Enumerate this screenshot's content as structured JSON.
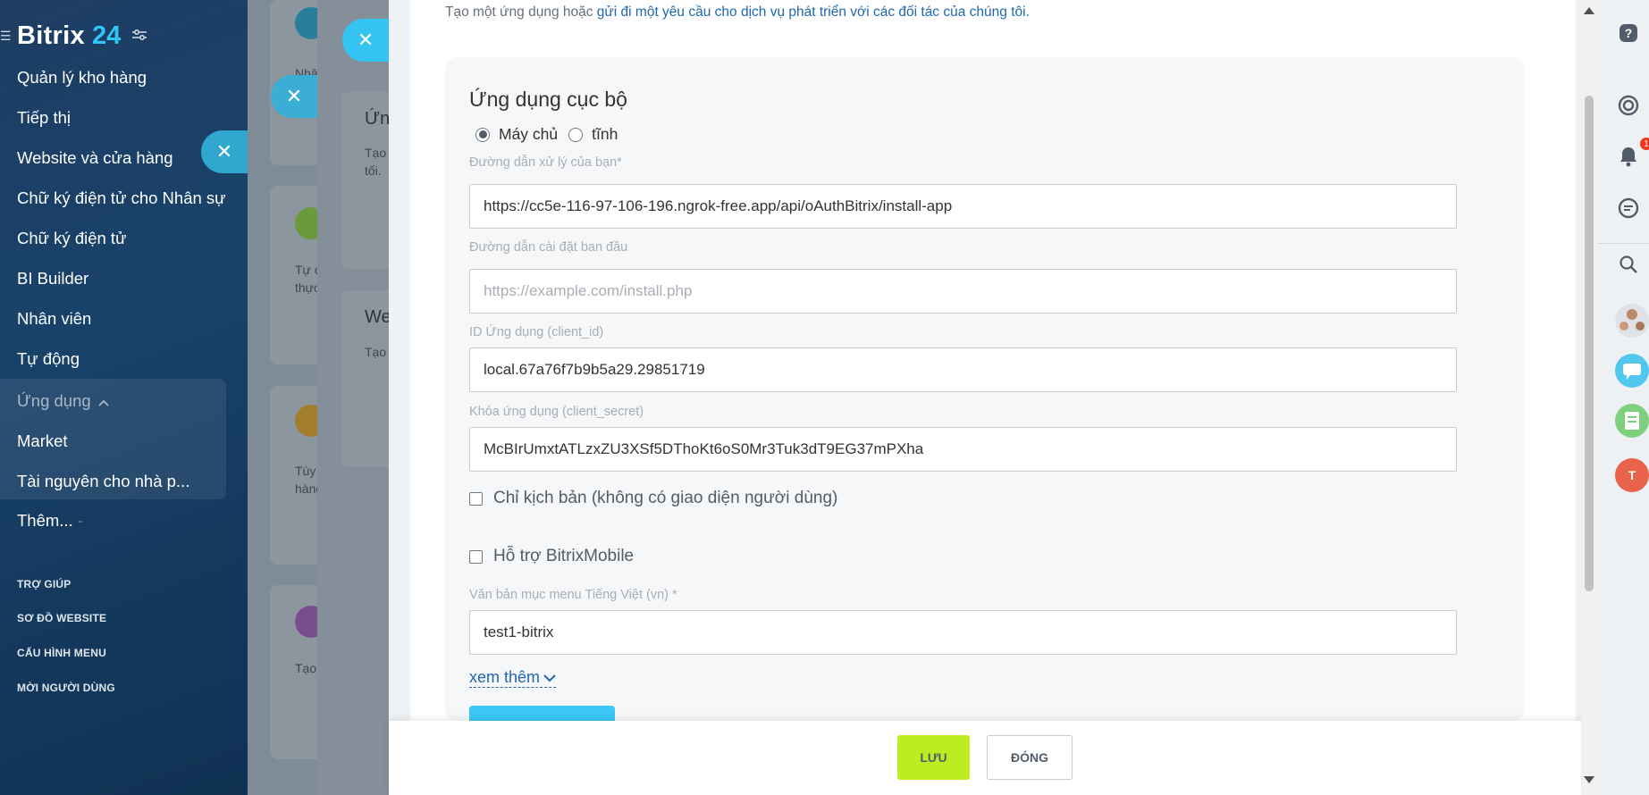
{
  "sidebar": {
    "brand": "Bitrix",
    "brand_num": "24",
    "items": [
      {
        "label": "Quản lý kho hàng"
      },
      {
        "label": "Tiếp thị"
      },
      {
        "label": "Website và cửa hàng"
      },
      {
        "label": "Chữ ký điện tử cho Nhân sự"
      },
      {
        "label": "Chữ ký điện tử"
      },
      {
        "label": "BI Builder"
      },
      {
        "label": "Nhân viên"
      },
      {
        "label": "Tự động"
      }
    ],
    "apps_group": {
      "label": "Ứng dụng",
      "items": [
        {
          "label": "Market"
        },
        {
          "label": "Tài nguyên cho nhà p..."
        }
      ]
    },
    "more_label": "Thêm...",
    "footer": [
      {
        "label": "TRỢ GIÚP"
      },
      {
        "label": "SƠ ĐỒ WEBSITE"
      },
      {
        "label": "CẤU HÌNH MENU"
      },
      {
        "label": "MỜI NGƯỜI DÙNG"
      }
    ]
  },
  "background": {
    "snippets": [
      "Nhâ",
      "Ứn",
      "Tạo",
      "tối.",
      "Tự c",
      "thực",
      "We",
      "Tạo",
      "Tùy",
      "hàng",
      "Tạo"
    ]
  },
  "form": {
    "intro_prefix": "Tạo một ứng dụng hoặc ",
    "intro_link": "gửi đi một yêu cầu cho dịch vụ phát triển với các đối tác của chúng tôi.",
    "title": "Ứng dụng cục bộ",
    "radio_server": "Máy chủ",
    "radio_static": "tĩnh",
    "handler_label": "Đường dẫn xử lý của bạn*",
    "handler_value": "https://cc5e-116-97-106-196.ngrok-free.app/api/oAuthBitrix/install-app",
    "install_label": "Đường dẫn cài đặt ban đầu",
    "install_placeholder": "https://example.com/install.php",
    "client_id_label": "ID Ứng dụng (client_id)",
    "client_id_value": "local.67a76f7b9b5a29.29851719",
    "client_secret_label": "Khóa ứng dụng (client_secret)",
    "client_secret_value": "McBIrUmxtATLzxZU3XSf5DThoKt6oS0Mr3Tuk3dT9EG37mPXha",
    "script_only_label": "Chỉ kịch bản (không có giao diện người dùng)",
    "mobile_label": "Hỗ trợ BitrixMobile",
    "menu_text_label": "Văn bản mục menu Tiếng Việt (vn) *",
    "menu_text_value": "test1-bitrix",
    "more_link": "xem thêm"
  },
  "buttons": {
    "save": "LƯU",
    "close": "ĐÓNG"
  },
  "rightbar": {
    "notification_count": "1",
    "avatar_letter": "T"
  },
  "colors": {
    "accent": "#2fc6f6",
    "save": "#bbed21",
    "link": "#2067b0"
  }
}
